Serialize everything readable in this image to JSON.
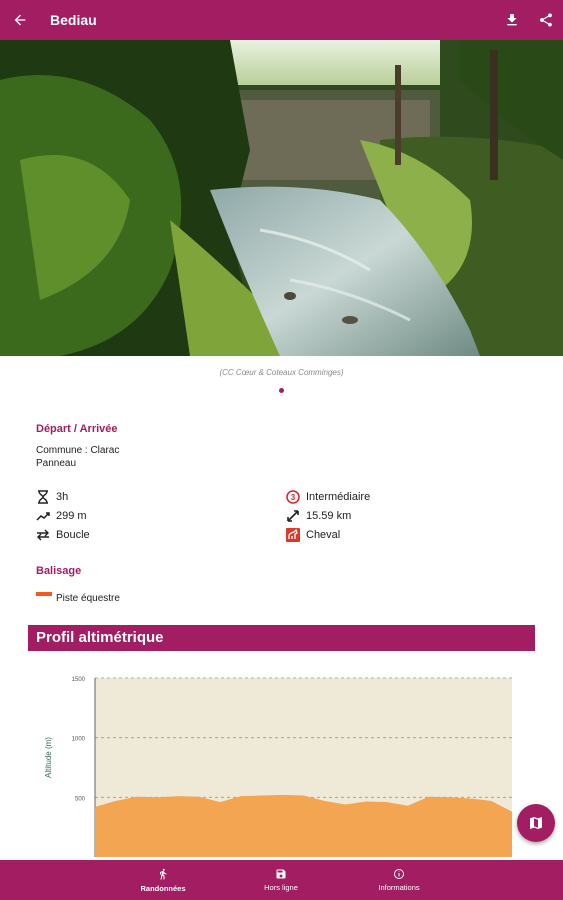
{
  "appbar": {
    "title": "Bediau",
    "back_icon": "arrow-left-icon",
    "download_icon": "download-icon",
    "share_icon": "share-icon"
  },
  "hero": {
    "caption": "(CC Cœur & Coteaux Comminges)"
  },
  "depart": {
    "title": "Départ / Arrivée",
    "commune": "Commune : Clarac",
    "detail": "Panneau"
  },
  "stats": {
    "duration": "3h",
    "difficulty": "Intermédiaire",
    "difficulty_level": "3",
    "elevation": "299 m",
    "distance": "15.59 km",
    "type": "Boucle",
    "practice": "Cheval"
  },
  "balisage": {
    "title": "Balisage",
    "item": "Piste équestre",
    "color": "#f05a22"
  },
  "profile": {
    "title": "Profil altimétrique"
  },
  "chart_data": {
    "type": "area",
    "ylabel": "Altitude (m)",
    "ylim": [
      0,
      1500
    ],
    "yticks": [
      "500",
      "1000",
      "1500"
    ],
    "ytick_values": [
      500,
      1000,
      1500
    ],
    "x": [
      0,
      1,
      2,
      3,
      4,
      5,
      6,
      7,
      8,
      9,
      10,
      11,
      12,
      13,
      14,
      15,
      16,
      17,
      18,
      19,
      20
    ],
    "values": [
      420,
      470,
      505,
      500,
      510,
      505,
      460,
      510,
      515,
      520,
      515,
      470,
      440,
      465,
      460,
      430,
      505,
      500,
      490,
      470,
      380
    ],
    "fill_color": "#f3a552",
    "bg_color": "#efe9d7"
  },
  "bottomnav": [
    {
      "label": "Randonnées",
      "icon": "hiker-icon",
      "active": true
    },
    {
      "label": "Hors ligne",
      "icon": "save-icon",
      "active": false
    },
    {
      "label": "Informations",
      "icon": "info-icon",
      "active": false
    }
  ],
  "fab": {
    "icon": "map-icon"
  }
}
